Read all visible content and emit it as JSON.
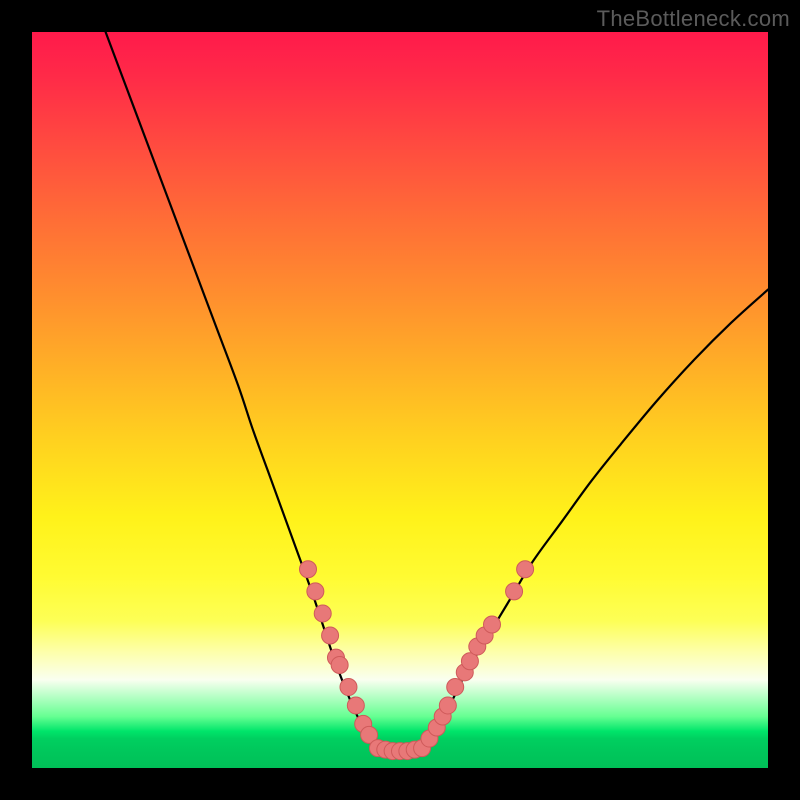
{
  "watermark": "TheBottleneck.com",
  "colors": {
    "frame": "#000000",
    "curve": "#000000",
    "dot_fill": "#e87878",
    "dot_stroke": "#cf5a5a",
    "gradient_top": "#ff1a4b",
    "gradient_bottom": "#00c058"
  },
  "chart_data": {
    "type": "line",
    "title": "",
    "xlabel": "",
    "ylabel": "",
    "xlim": [
      0,
      100
    ],
    "ylim": [
      0,
      100
    ],
    "grid": false,
    "legend": false,
    "series": [
      {
        "name": "left-branch",
        "x": [
          10,
          13,
          16,
          19,
          22,
          25,
          28,
          30,
          32,
          34,
          36,
          38,
          39.5,
          41,
          42.5,
          44,
          45.5,
          47
        ],
        "y": [
          100,
          92,
          84,
          76,
          68,
          60,
          52,
          46,
          40.5,
          35,
          29.5,
          24,
          19.5,
          15,
          11,
          7.5,
          4.5,
          2.7
        ]
      },
      {
        "name": "valley-floor",
        "x": [
          47,
          49,
          51,
          53
        ],
        "y": [
          2.7,
          2.3,
          2.3,
          2.7
        ]
      },
      {
        "name": "right-branch",
        "x": [
          53,
          55,
          57,
          59,
          62,
          65,
          68,
          72,
          76,
          80,
          85,
          90,
          95,
          100
        ],
        "y": [
          2.7,
          5.5,
          9,
          13,
          18,
          23,
          28,
          33.5,
          39,
          44,
          50,
          55.5,
          60.5,
          65
        ]
      }
    ],
    "markers": [
      {
        "branch": "left",
        "x": 37.5,
        "y": 27.0
      },
      {
        "branch": "left",
        "x": 38.5,
        "y": 24.0
      },
      {
        "branch": "left",
        "x": 39.5,
        "y": 21.0
      },
      {
        "branch": "left",
        "x": 40.5,
        "y": 18.0
      },
      {
        "branch": "left",
        "x": 41.3,
        "y": 15.0
      },
      {
        "branch": "left",
        "x": 41.8,
        "y": 14.0
      },
      {
        "branch": "left",
        "x": 43.0,
        "y": 11.0
      },
      {
        "branch": "left",
        "x": 44.0,
        "y": 8.5
      },
      {
        "branch": "left",
        "x": 45.0,
        "y": 6.0
      },
      {
        "branch": "left",
        "x": 45.8,
        "y": 4.5
      },
      {
        "branch": "floor",
        "x": 47.0,
        "y": 2.7
      },
      {
        "branch": "floor",
        "x": 48.0,
        "y": 2.5
      },
      {
        "branch": "floor",
        "x": 49.0,
        "y": 2.3
      },
      {
        "branch": "floor",
        "x": 50.0,
        "y": 2.3
      },
      {
        "branch": "floor",
        "x": 51.0,
        "y": 2.3
      },
      {
        "branch": "floor",
        "x": 52.0,
        "y": 2.5
      },
      {
        "branch": "floor",
        "x": 53.0,
        "y": 2.7
      },
      {
        "branch": "right",
        "x": 54.0,
        "y": 4.0
      },
      {
        "branch": "right",
        "x": 55.0,
        "y": 5.5
      },
      {
        "branch": "right",
        "x": 55.8,
        "y": 7.0
      },
      {
        "branch": "right",
        "x": 56.5,
        "y": 8.5
      },
      {
        "branch": "right",
        "x": 57.5,
        "y": 11.0
      },
      {
        "branch": "right",
        "x": 58.8,
        "y": 13.0
      },
      {
        "branch": "right",
        "x": 59.5,
        "y": 14.5
      },
      {
        "branch": "right",
        "x": 60.5,
        "y": 16.5
      },
      {
        "branch": "right",
        "x": 61.5,
        "y": 18.0
      },
      {
        "branch": "right",
        "x": 62.5,
        "y": 19.5
      },
      {
        "branch": "right",
        "x": 65.5,
        "y": 24.0
      },
      {
        "branch": "right",
        "x": 67.0,
        "y": 27.0
      }
    ]
  }
}
